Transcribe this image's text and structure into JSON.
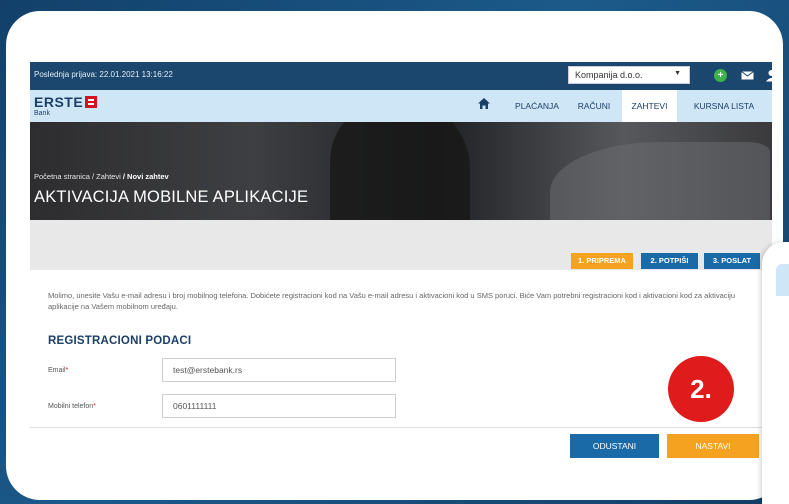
{
  "topbar": {
    "last_login": "Poslednja prijava: 22.01.2021 13:16:22",
    "company_select_value": "Kompanija d.o.o.",
    "icons": [
      "plus-circle-icon",
      "mail-icon",
      "user-icon"
    ]
  },
  "nav": {
    "logo_text": "ERSTE",
    "logo_sub": "Bank",
    "items": [
      {
        "label": "PLAĆANJA"
      },
      {
        "label": "RAČUNI"
      },
      {
        "label": "ZAHTEVI"
      },
      {
        "label": "KURSNA LISTA"
      }
    ],
    "active": "ZAHTEVI"
  },
  "hero": {
    "breadcrumb_home": "Početna stranica",
    "breadcrumb_sep": "/",
    "breadcrumb_requests": "Zahtevi",
    "breadcrumb_current": "Novi zahtev",
    "title": "AKTIVACIJA MOBILNE APLIKACIJE"
  },
  "steps": [
    {
      "label": "1. PRIPREMA"
    },
    {
      "label": "2. POTPIŠI"
    },
    {
      "label": "3. POSLAT"
    }
  ],
  "form": {
    "intro": "Molimo, unesite Vašu e-mail adresu i broj mobilnog telefona. Dobićete registracioni kod na Vašu e-mail adresu i aktivacioni kod u SMS poruci. Biće Vam potrebni registracioni kod i aktivacioni kod za aktivaciju aplikacije na Vašem mobilnom uređaju.",
    "section_title": "REGISTRACIONI PODACI",
    "email_label": "Email",
    "email_value": "test@erstebank.rs",
    "phone_label": "Mobilni telefon",
    "phone_value": "0601111111",
    "required_mark": "*"
  },
  "buttons": {
    "cancel": "ODUSTANI",
    "next": "NASTAVI"
  },
  "badge": "2.",
  "colors": {
    "topbar": "#1b466d",
    "nav": "#cfe6f6",
    "accent_orange": "#f4a21f",
    "accent_blue": "#1a6aa8",
    "badge_red": "#e01b1b"
  }
}
